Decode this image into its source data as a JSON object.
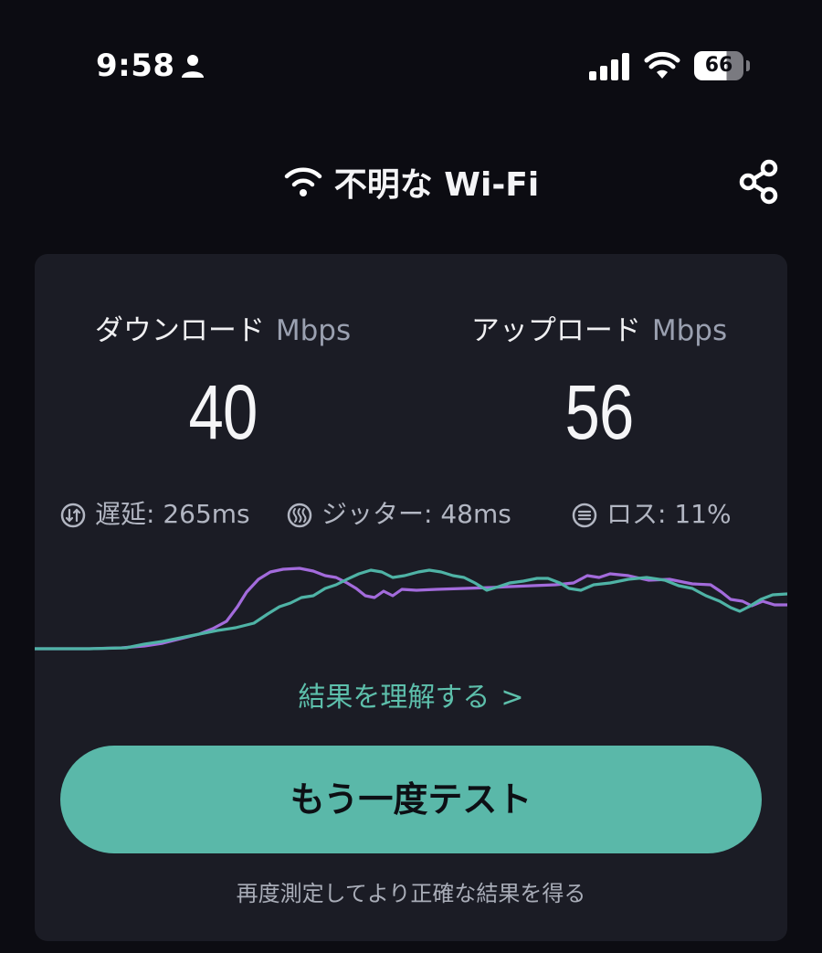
{
  "status_bar": {
    "time": "9:58",
    "battery": "66"
  },
  "header": {
    "network_name": "不明な Wi-Fi"
  },
  "download": {
    "label": "ダウンロード",
    "unit": "Mbps",
    "value": "40"
  },
  "upload": {
    "label": "アップロード",
    "unit": "Mbps",
    "value": "56"
  },
  "stats": {
    "latency": "遅延: 265ms",
    "jitter": "ジッター: 48ms",
    "loss": "ロス: 11%"
  },
  "links": {
    "understand": "結果を理解する",
    "chevron": ">"
  },
  "buttons": {
    "retest": "もう一度テスト"
  },
  "hint": "再度測定してより正確な結果を得る",
  "colors": {
    "background": "#0c0c12",
    "card": "#1b1c25",
    "accent": "#5ab8a9",
    "download_series": "#a36bdc",
    "upload_series": "#4fb3a6"
  },
  "icons": {
    "person": "person-icon",
    "signal": "cellular-signal-icon",
    "wifi": "wifi-icon",
    "share": "share-icon",
    "latency": "latency-icon",
    "jitter": "jitter-icon",
    "loss": "loss-icon"
  }
}
